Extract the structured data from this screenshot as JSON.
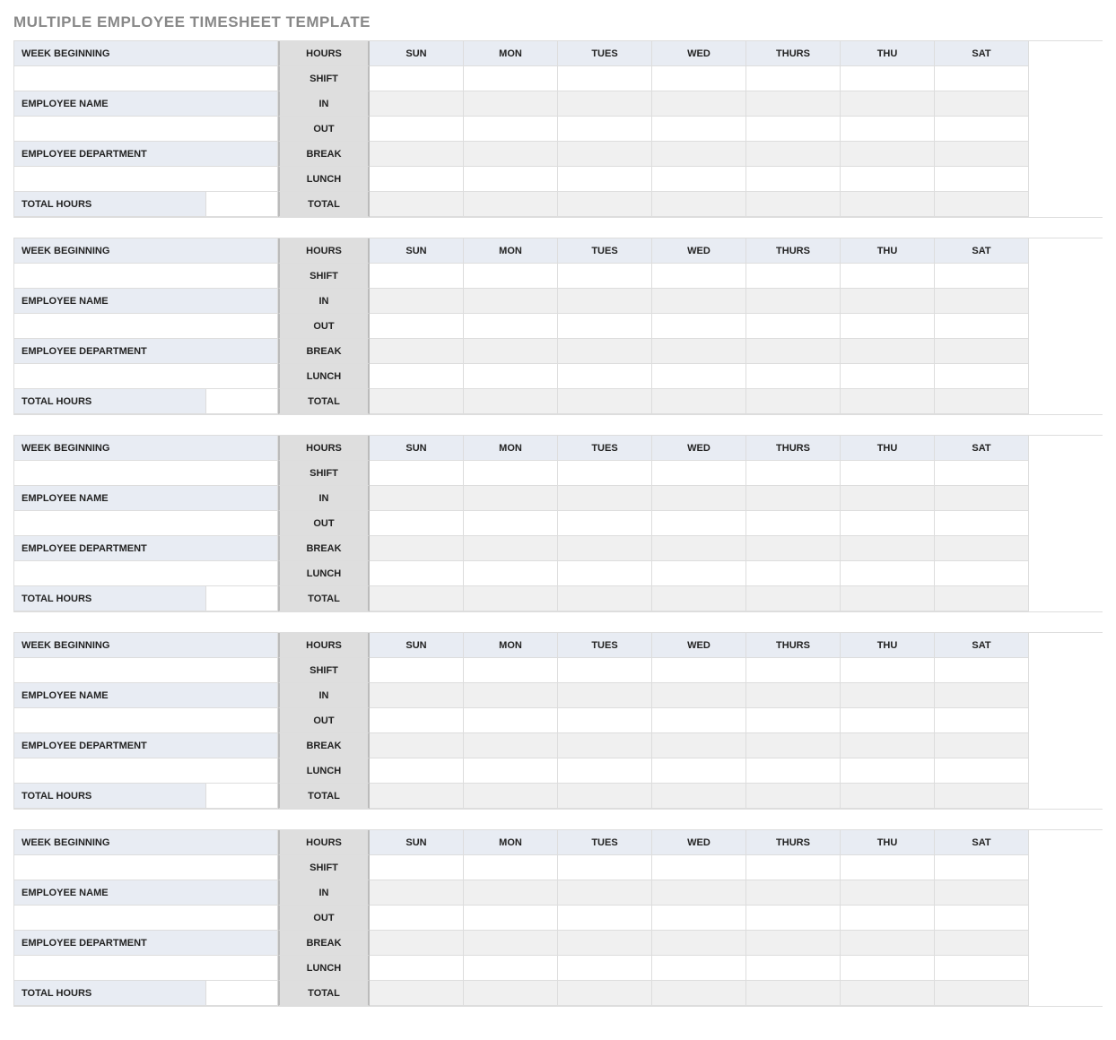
{
  "title": "MULTIPLE EMPLOYEE TIMESHEET TEMPLATE",
  "labels": {
    "week_beginning": "WEEK BEGINNING",
    "employee_name": "EMPLOYEE NAME",
    "employee_department": "EMPLOYEE DEPARTMENT",
    "total_hours": "TOTAL HOURS",
    "hours": "HOURS",
    "shift": "SHIFT",
    "in": "IN",
    "out": "OUT",
    "break": "BREAK",
    "lunch": "LUNCH",
    "total": "TOTAL"
  },
  "days": [
    "SUN",
    "MON",
    "TUES",
    "WED",
    "THURS",
    "THU",
    "SAT"
  ],
  "blocks": [
    {
      "week_beginning": "",
      "employee_name": "",
      "employee_department": "",
      "total_hours": "",
      "cells": {}
    },
    {
      "week_beginning": "",
      "employee_name": "",
      "employee_department": "",
      "total_hours": "",
      "cells": {}
    },
    {
      "week_beginning": "",
      "employee_name": "",
      "employee_department": "",
      "total_hours": "",
      "cells": {}
    },
    {
      "week_beginning": "",
      "employee_name": "",
      "employee_department": "",
      "total_hours": "",
      "cells": {}
    },
    {
      "week_beginning": "",
      "employee_name": "",
      "employee_department": "",
      "total_hours": "",
      "cells": {}
    }
  ]
}
